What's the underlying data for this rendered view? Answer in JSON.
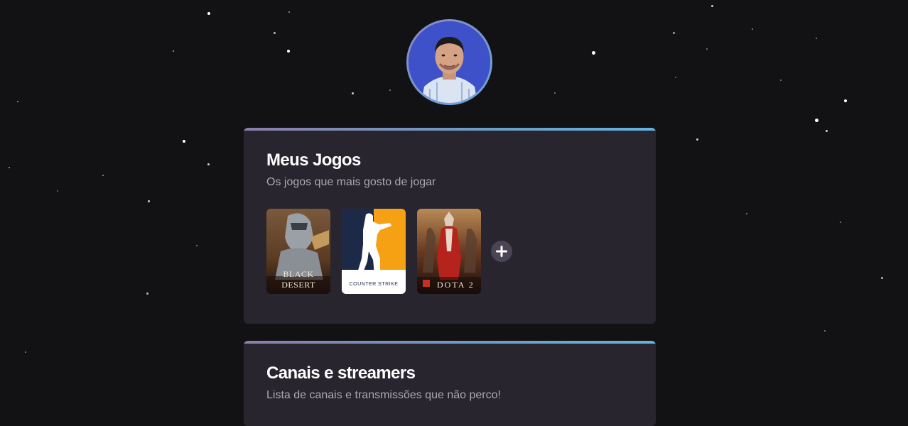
{
  "profile": {
    "avatar_alt": "profile photo"
  },
  "games_section": {
    "title": "Meus Jogos",
    "subtitle": "Os jogos que mais gosto de jogar",
    "games": [
      {
        "name": "BLACK DESERT"
      },
      {
        "name": "COUNTER STRIKE"
      },
      {
        "name": "DOTA 2"
      }
    ],
    "add_icon": "plus-icon"
  },
  "streams_section": {
    "title": "Canais e streamers",
    "subtitle": "Lista de canais e transmissões que não perco!"
  },
  "colors": {
    "background": "#121214",
    "card": "#29252f",
    "accent_start": "#8a7ea8",
    "accent_end": "#63b3dc"
  }
}
